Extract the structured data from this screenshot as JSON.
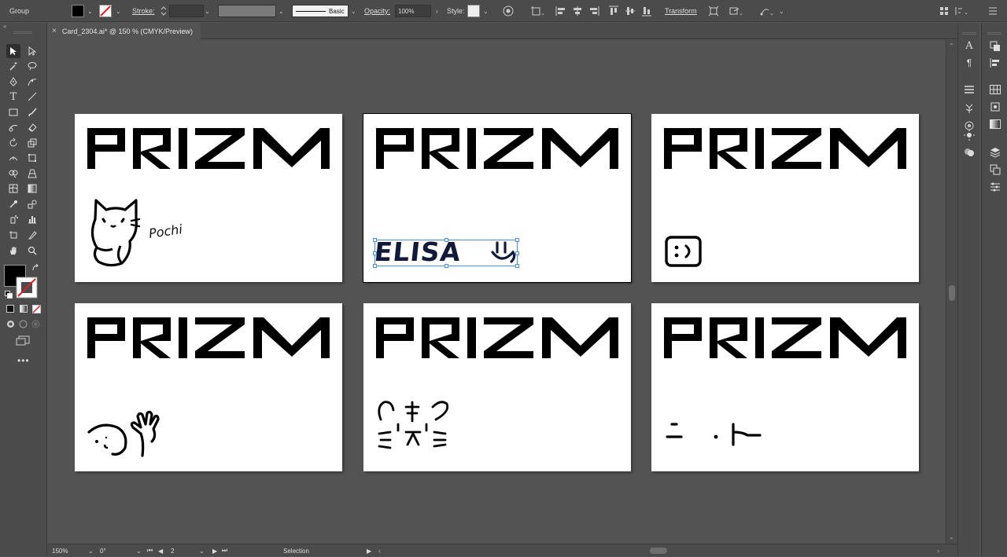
{
  "control_bar": {
    "selection_label": "Group",
    "stroke_label": "Stroke:",
    "stroke_profile": "Basic",
    "opacity_label": "Opacity:",
    "opacity_value": "100%",
    "style_label": "Style:",
    "transform_label": "Transform"
  },
  "document": {
    "tab_title": "Card_2304.ai* @ 150 % (CMYK/Preview)"
  },
  "artboards": {
    "logo_text": "PRIZM",
    "pochi_name": "Pochi",
    "elisa_name": "ELISA"
  },
  "status_bar": {
    "zoom": "150%",
    "rotation": "0°",
    "artboard_number": "2",
    "tool_name": "Selection"
  },
  "colors": {
    "ui_background": "#535353",
    "panel": "#4b4b4b",
    "selection_blue": "#4a8fe0",
    "fill": "#000000"
  }
}
